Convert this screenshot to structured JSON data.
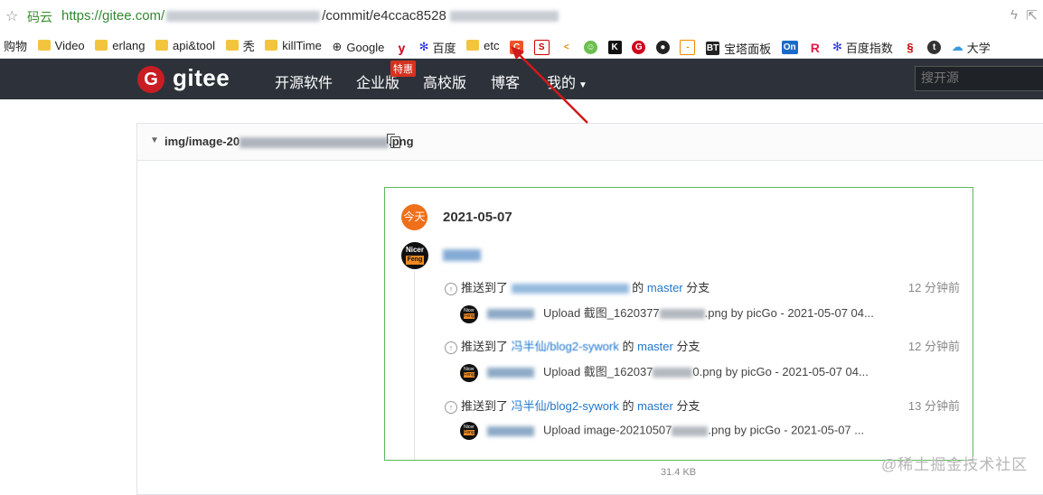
{
  "address_bar": {
    "site_name": "码云",
    "url_prefix": "https://gitee.com/",
    "url_commit": "/commit/e4ccac8528"
  },
  "bookmarks": [
    {
      "label": "购物",
      "icon": "none"
    },
    {
      "label": "Video",
      "icon": "folder-icon"
    },
    {
      "label": "erlang",
      "icon": "folder-icon"
    },
    {
      "label": "api&tool",
      "icon": "folder-icon"
    },
    {
      "label": "秃",
      "icon": "folder-icon"
    },
    {
      "label": "killTime",
      "icon": "folder-icon"
    },
    {
      "label": "Google",
      "icon": "globe-icon"
    },
    {
      "label": "百度",
      "icon": "baidu-paw-icon"
    },
    {
      "label": "etc",
      "icon": "folder-icon"
    },
    {
      "label": "宝塔面板",
      "icon": "bt-icon"
    },
    {
      "label": "百度指数",
      "icon": "baidu-paw-icon"
    },
    {
      "label": "大学",
      "icon": "cloud-icon"
    }
  ],
  "header": {
    "logo_text": "gitee",
    "nav": [
      "开源软件",
      "企业版",
      "高校版",
      "博客",
      "我的"
    ],
    "badge": "特惠",
    "search_placeholder": "搜开源"
  },
  "file": {
    "path_start": "img/image-20",
    "path_end": "png"
  },
  "activity": {
    "today_badge": "今天",
    "date": "2021-05-07",
    "events": [
      {
        "pushed_to": "推送到了",
        "repo": "",
        "of": "的",
        "branch": "master",
        "branch_word": "分支",
        "time": "12 分钟前",
        "commit_text": "Upload 截图_1620377",
        "commit_tail": ".png by picGo - 2021-05-07 04..."
      },
      {
        "pushed_to": "推送到了",
        "repo": "冯半仙/blog2-sywork",
        "of": "的",
        "branch": "master",
        "branch_word": "分支",
        "time": "12 分钟前",
        "commit_text": "Upload 截图_162037",
        "commit_tail": "0.png by picGo - 2021-05-07 04..."
      },
      {
        "pushed_to": "推送到了",
        "repo": "冯半仙/blog2-sywork",
        "of": "的",
        "branch": "master",
        "branch_word": "分支",
        "time": "13 分钟前",
        "commit_text": "Upload image-20210507",
        "commit_tail": ".png by picGo - 2021-05-07 ..."
      }
    ]
  },
  "file_size": "31.4 KB",
  "watermark": "@稀土掘金技术社区",
  "colors": {
    "header_bg": "#2d323a",
    "gitee_red": "#c71d23",
    "today_orange": "#ef6f1b",
    "frame_green": "#5cb85c",
    "link_blue": "#2277cc",
    "arrow_red": "#d11a1a"
  }
}
